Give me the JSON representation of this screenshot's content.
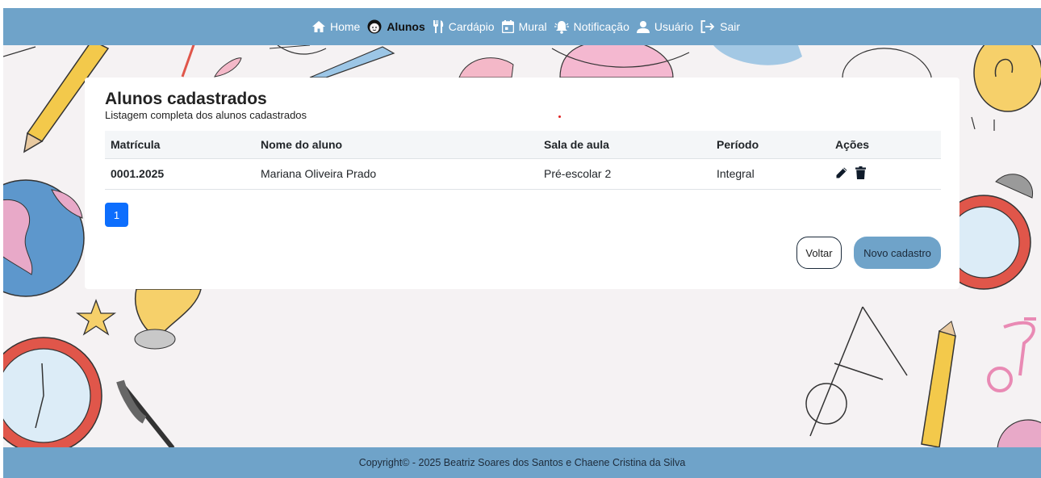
{
  "nav": {
    "items": [
      {
        "label": "Home",
        "icon": "home-icon",
        "active": false
      },
      {
        "label": "Alunos",
        "icon": "child-face-icon",
        "active": true
      },
      {
        "label": "Cardápio",
        "icon": "utensils-icon",
        "active": false
      },
      {
        "label": "Mural",
        "icon": "calendar-icon",
        "active": false
      },
      {
        "label": "Notificação",
        "icon": "bell-icon",
        "active": false
      },
      {
        "label": "Usuário",
        "icon": "user-icon",
        "active": false
      },
      {
        "label": "Sair",
        "icon": "logout-icon",
        "active": false
      }
    ]
  },
  "card": {
    "title": "Alunos cadastrados",
    "subtitle": "Listagem completa dos alunos cadastrados"
  },
  "table": {
    "headers": {
      "matricula": "Matrícula",
      "nome": "Nome do aluno",
      "sala": "Sala de aula",
      "periodo": "Período",
      "acoes": "Ações"
    },
    "rows": [
      {
        "matricula": "0001.2025",
        "nome": "Mariana Oliveira Prado",
        "sala": "Pré-escolar 2",
        "periodo": "Integral"
      }
    ]
  },
  "pagination": {
    "current": "1"
  },
  "buttons": {
    "voltar": "Voltar",
    "novo": "Novo cadastro"
  },
  "footer": {
    "text": "Copyright© - 2025 Beatriz Soares dos Santos e Chaene Cristina da Silva"
  },
  "colors": {
    "nav": "#6fa3c9",
    "primary": "#0d6efd",
    "background": "#f5f2f3"
  }
}
